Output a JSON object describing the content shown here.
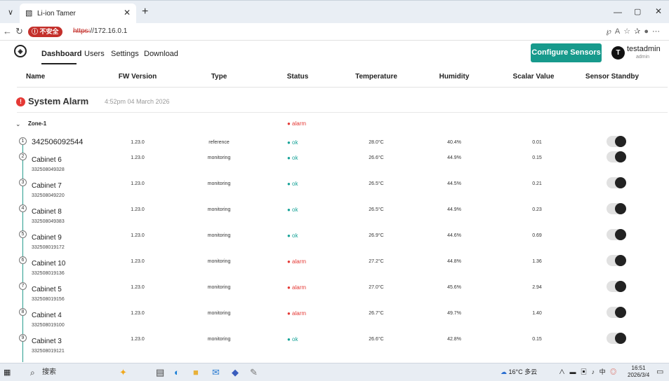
{
  "browser": {
    "tab_title": "Li-ion Tamer",
    "insecure_label": "不安全",
    "url_scheme": "https:",
    "url_rest": "//172.16.0.1",
    "icons": [
      "chevron-down-icon",
      "close-icon",
      "plus-icon",
      "minimize-icon",
      "maximize-icon",
      "close-window-icon",
      "back-icon",
      "reload-icon",
      "read-aloud-icon",
      "favorites-icon",
      "collections-icon",
      "profile-icon"
    ]
  },
  "app": {
    "nav": [
      "Dashboard",
      "Users",
      "Settings",
      "Download"
    ],
    "active_nav": "Dashboard",
    "configure_button": "Configure Sensors",
    "user": {
      "initial": "T",
      "name": "testadmin",
      "role": "admin"
    },
    "accent_color": "#179a8c"
  },
  "table": {
    "headers": [
      "Name",
      "FW Version",
      "Type",
      "Status",
      "Temperature",
      "Humidity",
      "Scalar Value",
      "Sensor Standby"
    ]
  },
  "system_alarm": {
    "badge": "!",
    "title": "System Alarm",
    "time": "4:52pm 04 March 2026"
  },
  "zone": {
    "chevron": "⌄",
    "name": "Zone-1",
    "status": "● alarm"
  },
  "rows": [
    {
      "idx": "1",
      "name": "342506092544",
      "serial": "",
      "fw": "1.23.0",
      "type": "reference",
      "status": "● ok",
      "temp": "28.0°C",
      "hum": "40.4%",
      "scalar": "0.01"
    },
    {
      "idx": "2",
      "name": "Cabinet 6",
      "serial": "332508049328",
      "fw": "1.23.0",
      "type": "monitoring",
      "status": "● ok",
      "temp": "26.6°C",
      "hum": "44.9%",
      "scalar": "0.15"
    },
    {
      "idx": "3",
      "name": "Cabinet 7",
      "serial": "332508049220",
      "fw": "1.23.0",
      "type": "monitoring",
      "status": "● ok",
      "temp": "26.5°C",
      "hum": "44.5%",
      "scalar": "0.21"
    },
    {
      "idx": "4",
      "name": "Cabinet 8",
      "serial": "332508049383",
      "fw": "1.23.0",
      "type": "monitoring",
      "status": "● ok",
      "temp": "26.5°C",
      "hum": "44.9%",
      "scalar": "0.23"
    },
    {
      "idx": "5",
      "name": "Cabinet 9",
      "serial": "332508019172",
      "fw": "1.23.0",
      "type": "monitoring",
      "status": "● ok",
      "temp": "26.9°C",
      "hum": "44.6%",
      "scalar": "0.69"
    },
    {
      "idx": "6",
      "name": "Cabinet 10",
      "serial": "332508019136",
      "fw": "1.23.0",
      "type": "monitoring",
      "status": "● alarm",
      "temp": "27.2°C",
      "hum": "44.8%",
      "scalar": "1.36"
    },
    {
      "idx": "7",
      "name": "Cabinet 5",
      "serial": "332508019156",
      "fw": "1.23.0",
      "type": "monitoring",
      "status": "● alarm",
      "temp": "27.0°C",
      "hum": "45.6%",
      "scalar": "2.94"
    },
    {
      "idx": "8",
      "name": "Cabinet 4",
      "serial": "332508019100",
      "fw": "1.23.0",
      "type": "monitoring",
      "status": "● alarm",
      "temp": "26.7°C",
      "hum": "49.7%",
      "scalar": "1.40"
    },
    {
      "idx": "9",
      "name": "Cabinet 3",
      "serial": "332508019121",
      "fw": "1.23.0",
      "type": "monitoring",
      "status": "● ok",
      "temp": "26.6°C",
      "hum": "42.8%",
      "scalar": "0.15"
    }
  ],
  "status_colors": {
    "ok": "#17a398",
    "alarm": "#e53935"
  },
  "taskbar": {
    "search_label": "搜索",
    "weather": "16°C 多云",
    "ime": "中",
    "time": "16:51",
    "date": "2026/3/4",
    "icons": [
      "windows-start-icon",
      "search-icon",
      "copilot-icon",
      "task-view-icon",
      "edge-icon",
      "file-explorer-icon",
      "mail-icon",
      "app-icon",
      "pen-icon",
      "weather-icon",
      "tray-chevron-icon",
      "network-icon",
      "volume-icon",
      "notification-icon"
    ]
  }
}
